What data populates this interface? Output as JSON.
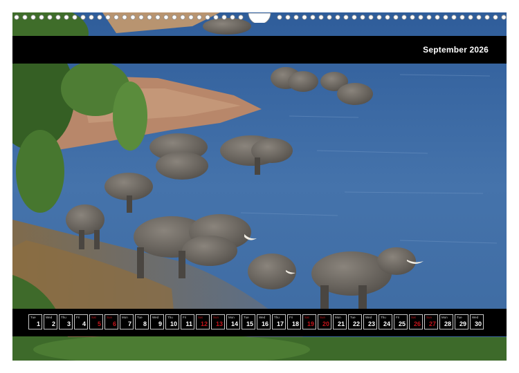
{
  "calendar": {
    "month_title": "September 2026",
    "highlight_color": "#c4141b",
    "days": [
      {
        "weekday": "Tue",
        "num": "1",
        "red": false
      },
      {
        "weekday": "Wed",
        "num": "2",
        "red": false
      },
      {
        "weekday": "Thu",
        "num": "3",
        "red": false
      },
      {
        "weekday": "Fri",
        "num": "4",
        "red": false
      },
      {
        "weekday": "Sat",
        "num": "5",
        "red": true
      },
      {
        "weekday": "Sun",
        "num": "6",
        "red": true
      },
      {
        "weekday": "Mon",
        "num": "7",
        "red": false
      },
      {
        "weekday": "Tue",
        "num": "8",
        "red": false
      },
      {
        "weekday": "Wed",
        "num": "9",
        "red": false
      },
      {
        "weekday": "Thu",
        "num": "10",
        "red": false
      },
      {
        "weekday": "Fri",
        "num": "11",
        "red": false
      },
      {
        "weekday": "Sat",
        "num": "12",
        "red": true
      },
      {
        "weekday": "Sun",
        "num": "13",
        "red": true
      },
      {
        "weekday": "Mon",
        "num": "14",
        "red": false
      },
      {
        "weekday": "Tue",
        "num": "15",
        "red": false
      },
      {
        "weekday": "Wed",
        "num": "16",
        "red": false
      },
      {
        "weekday": "Thu",
        "num": "17",
        "red": false
      },
      {
        "weekday": "Fri",
        "num": "18",
        "red": false
      },
      {
        "weekday": "Sat",
        "num": "19",
        "red": true
      },
      {
        "weekday": "Sun",
        "num": "20",
        "red": true
      },
      {
        "weekday": "Mon",
        "num": "21",
        "red": false
      },
      {
        "weekday": "Tue",
        "num": "22",
        "red": false
      },
      {
        "weekday": "Wed",
        "num": "23",
        "red": false
      },
      {
        "weekday": "Thu",
        "num": "24",
        "red": false
      },
      {
        "weekday": "Fri",
        "num": "25",
        "red": false
      },
      {
        "weekday": "Sat",
        "num": "26",
        "red": true
      },
      {
        "weekday": "Sun",
        "num": "27",
        "red": true
      },
      {
        "weekday": "Mon",
        "num": "28",
        "red": false
      },
      {
        "weekday": "Tue",
        "num": "29",
        "red": false
      },
      {
        "weekday": "Wed",
        "num": "30",
        "red": false
      }
    ]
  }
}
